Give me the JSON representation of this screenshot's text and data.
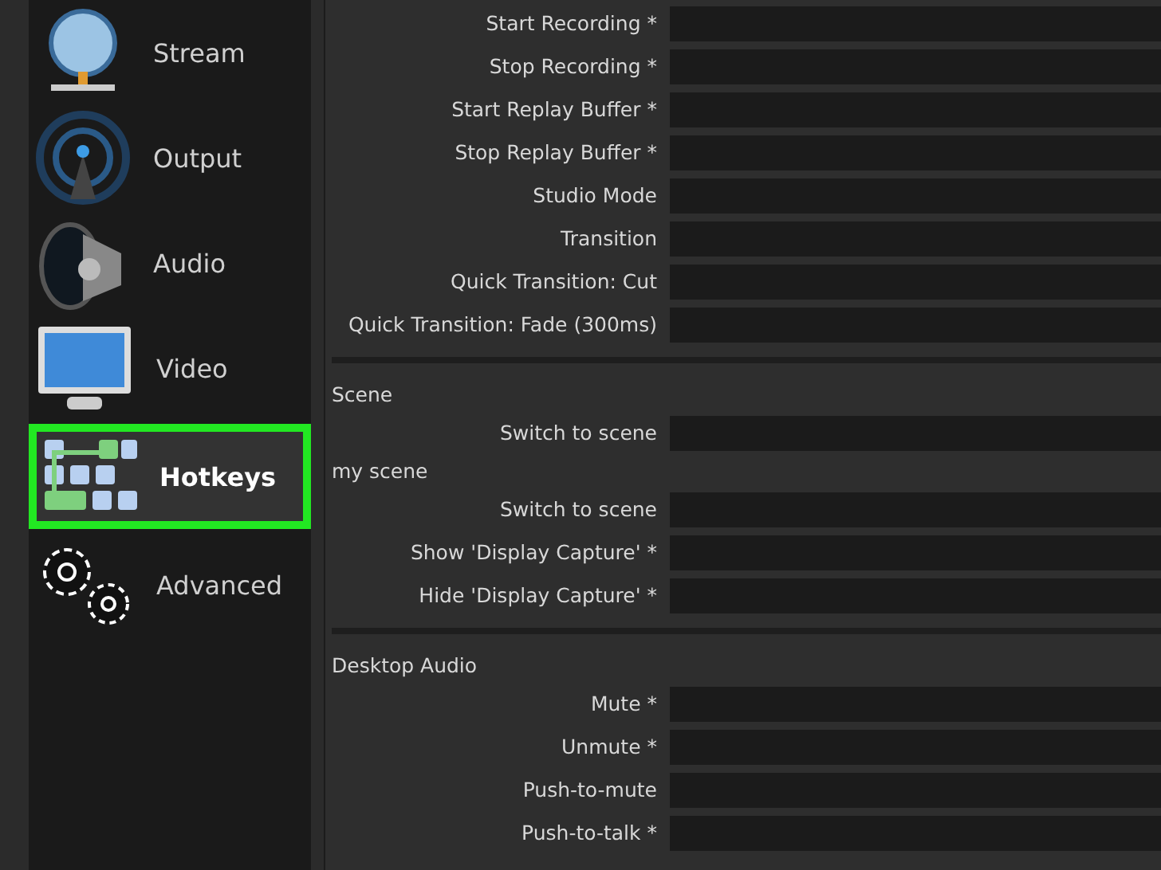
{
  "sidebar": {
    "items": [
      {
        "label": "Stream",
        "selected": false
      },
      {
        "label": "Output",
        "selected": false
      },
      {
        "label": "Audio",
        "selected": false
      },
      {
        "label": "Video",
        "selected": false
      },
      {
        "label": "Hotkeys",
        "selected": true
      },
      {
        "label": "Advanced",
        "selected": false
      }
    ]
  },
  "hotkeys": {
    "sections": [
      {
        "groups": [
          {
            "actions": [
              "Start Recording *",
              "Stop Recording *",
              "Start Replay Buffer *",
              "Stop Replay Buffer *",
              "Studio Mode",
              "Transition",
              "Quick Transition: Cut",
              "Quick Transition: Fade (300ms)"
            ]
          }
        ]
      },
      {
        "groups": [
          {
            "title": "Scene",
            "actions": [
              "Switch to scene"
            ]
          },
          {
            "title": "my scene",
            "actions": [
              "Switch to scene",
              "Show 'Display Capture' *",
              "Hide 'Display Capture' *"
            ]
          }
        ]
      },
      {
        "groups": [
          {
            "title": "Desktop Audio",
            "actions": [
              "Mute *",
              "Unmute *",
              "Push-to-mute",
              "Push-to-talk *"
            ]
          }
        ]
      }
    ]
  }
}
